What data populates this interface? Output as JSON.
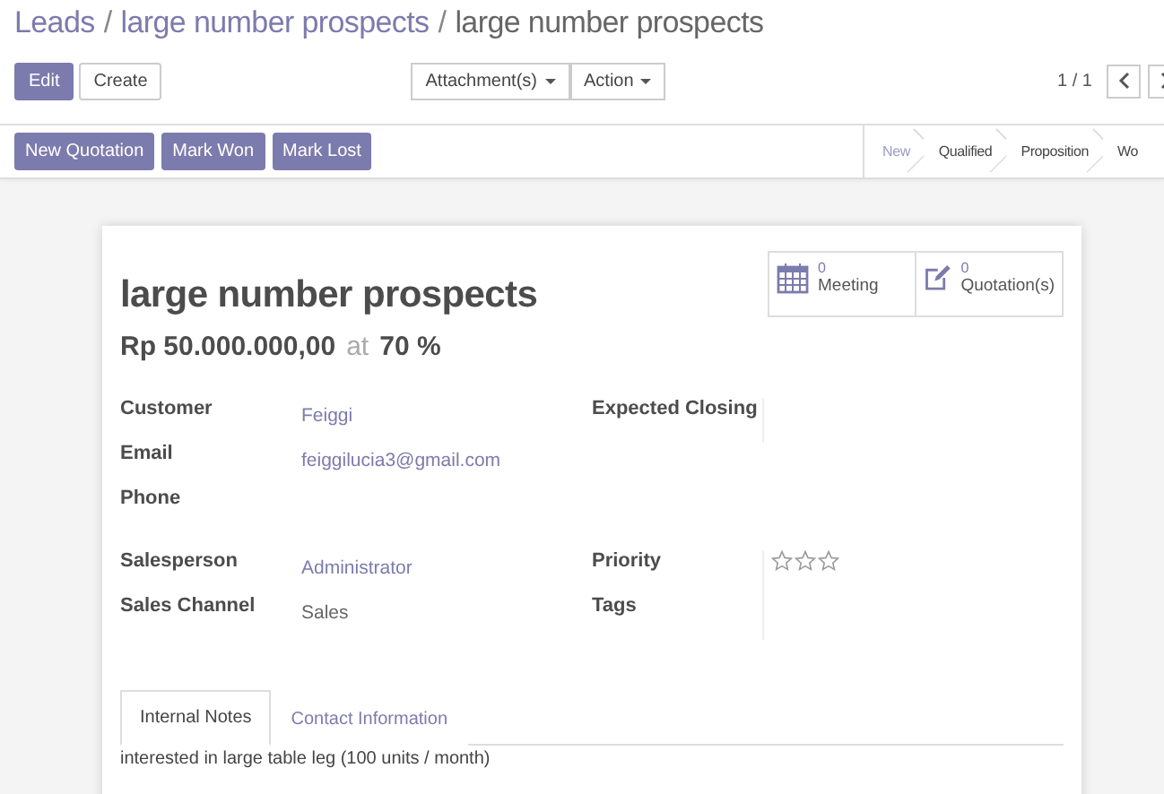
{
  "breadcrumbs": {
    "separator": "/",
    "items": [
      {
        "label": "Leads"
      },
      {
        "label": "large number prospects"
      },
      {
        "label": "large number prospects"
      }
    ]
  },
  "toolbar": {
    "buttons": [
      {
        "label": "Edit",
        "kind": "primary"
      },
      {
        "label": "Create",
        "kind": "secondary"
      }
    ],
    "dropdowns": [
      "Attachment(s)",
      "Action"
    ],
    "pager": "1 / 1"
  },
  "action_buttons": [
    "New Quotation",
    "Mark Won",
    "Mark Lost"
  ],
  "stages": [
    {
      "label": "New",
      "selected": true
    },
    {
      "label": "Qualified",
      "selected": false
    },
    {
      "label": "Proposition",
      "selected": false
    },
    {
      "label": "Wo",
      "selected": false
    }
  ],
  "stat_buttons": [
    {
      "kind": "calendar",
      "count": "0",
      "label": "Meeting"
    },
    {
      "kind": "edit",
      "count": "0",
      "label": "Quotation(s)"
    }
  ],
  "title": "large number prospects",
  "revenue": {
    "amount": "Rp 50.000.000,00",
    "at": "at",
    "probability": "70 %"
  },
  "groups": [
    {
      "left": [
        {
          "label": "Customer",
          "value": "Feiggi",
          "kind": "link"
        },
        {
          "label": "Email",
          "value": "feiggilucia3@gmail.com",
          "kind": "link"
        },
        {
          "label": "Phone",
          "kind": "text"
        }
      ],
      "right": [
        {
          "label": "Expected Closing",
          "kind": "text"
        }
      ]
    },
    {
      "left": [
        {
          "label": "Salesperson",
          "value": "Administrator",
          "kind": "link"
        },
        {
          "label": "Sales Channel",
          "value": "Sales",
          "kind": "text"
        }
      ],
      "right": [
        {
          "label": "Priority",
          "kind": "stars",
          "stars": 0
        },
        {
          "label": "Tags",
          "kind": "text"
        }
      ]
    }
  ],
  "tabs": [
    {
      "label": "Internal Notes",
      "selected": true
    },
    {
      "label": "Contact Information",
      "selected": false
    }
  ],
  "notes": "interested in large table leg (100 units / month)"
}
